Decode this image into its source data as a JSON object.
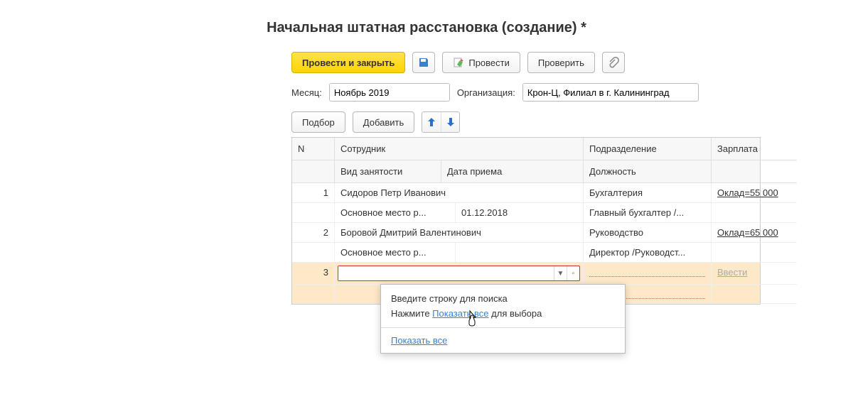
{
  "title": "Начальная штатная расстановка (создание) *",
  "toolbar": {
    "post_close": "Провести и закрыть",
    "post": "Провести",
    "check": "Проверить"
  },
  "form": {
    "month_label": "Месяц:",
    "month_value": "Ноябрь 2019",
    "org_label": "Организация:",
    "org_value": "Крон-Ц, Филиал в г. Калининград"
  },
  "toolbar2": {
    "podbor": "Подбор",
    "add": "Добавить"
  },
  "grid": {
    "head": {
      "n": "N",
      "employee": "Сотрудник",
      "dept": "Подразделение",
      "salary": "Зарплата",
      "employment_type": "Вид занятости",
      "hire_date": "Дата приема",
      "position": "Должность"
    },
    "rows": [
      {
        "n": "1",
        "employee": "Сидоров Петр Иванович",
        "dept": "Бухгалтерия",
        "salary": "Оклад=55 000",
        "employment_type": "Основное место р...",
        "hire_date": "01.12.2018",
        "position": "Главный бухгалтер /..."
      },
      {
        "n": "2",
        "employee": "Боровой Дмитрий Валентинович",
        "dept": "Руководство",
        "salary": "Оклад=65 000",
        "employment_type": "Основное место р...",
        "hire_date": "",
        "position": "Директор /Руководст..."
      }
    ],
    "active_row": {
      "n": "3",
      "enter_label": "Ввести"
    }
  },
  "popup": {
    "search_hint": "Введите строку для поиска",
    "press": "Нажмите ",
    "show_all_inline": "Показать все",
    "for_select": " для выбора",
    "show_all": "Показать все"
  }
}
